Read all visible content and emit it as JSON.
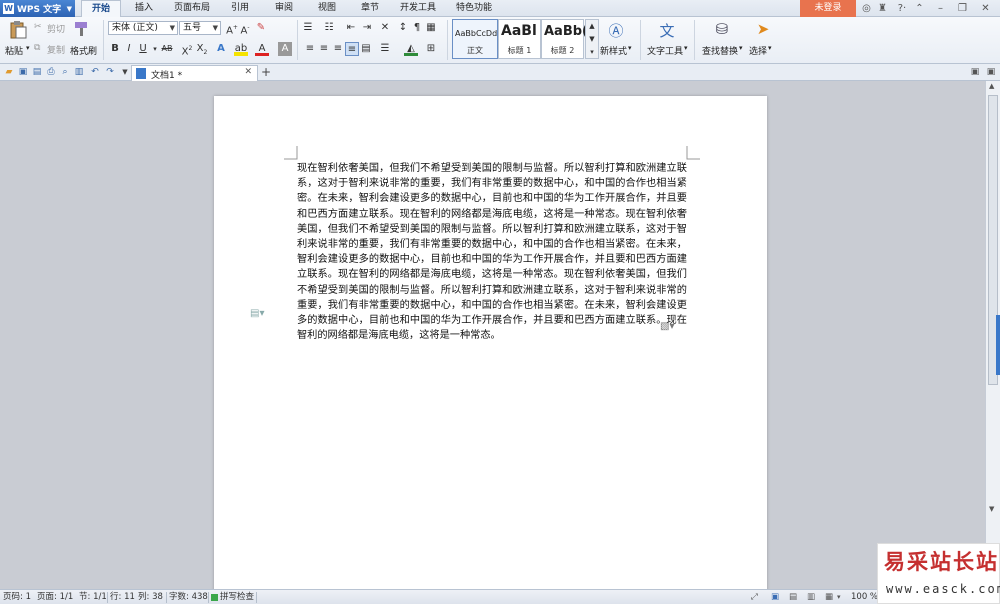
{
  "titlebar": {
    "app_name": "WPS 文字",
    "menu_tabs": [
      "开始",
      "插入",
      "页面布局",
      "引用",
      "审阅",
      "视图",
      "章节",
      "开发工具",
      "特色功能"
    ],
    "login": "未登录"
  },
  "ribbon": {
    "paste": "粘贴",
    "cut": "剪切",
    "copy": "复制",
    "format_painter": "格式刷",
    "font_name": "宋体 (正文)",
    "font_size": "五号",
    "styles": [
      {
        "sample": "AaBbCcDd",
        "label": "正文"
      },
      {
        "sample": "AaBl",
        "label": "标题 1"
      },
      {
        "sample": "AaBb(",
        "label": "标题 2"
      }
    ],
    "new_style": "新样式",
    "text_tools": "文字工具",
    "find_replace": "查找替换",
    "select": "选择"
  },
  "doc_tab": {
    "title": "文档1 *"
  },
  "document": {
    "text": "现在智利依奢美国，但我们不希望受到美国的限制与监督。所以智利打算和欧洲建立联系，这对于智利来说非常的重要，我们有非常重要的数据中心，和中国的合作也相当紧密。在未来，智利会建设更多的数据中心，目前也和中国的华为工作开展合作，并且要和巴西方面建立联系。现在智利的网络都是海底电缆，这将是一种常态。现在智利依奢美国，但我们不希望受到美国的限制与监督。所以智利打算和欧洲建立联系，这对于智利来说非常的重要，我们有非常重要的数据中心，和中国的合作也相当紧密。在未来，智利会建设更多的数据中心，目前也和中国的华为工作开展合作，并且要和巴西方面建立联系。现在智利的网络都是海底电缆，这将是一种常态。现在智利依奢美国，但我们不希望受到美国的限制与监督。所以智利打算和欧洲建立联系，这对于智利来说非常的重要，我们有非常重要的数据中心，和中国的合作也相当紧密。在未来，智利会建设更多的数据中心，目前也和中国的华为工作开展合作，并且要和巴西方面建立联系。现在智利的网络都是海底电缆，这将是一种常态。"
  },
  "statusbar": {
    "page_no": "页码: 1",
    "pages": "页面: 1/1",
    "section": "节: 1/1",
    "row": "行: 11",
    "col": "列: 38",
    "word_count": "字数: 438",
    "spell_check": "拼写检查",
    "zoom": "100 %"
  },
  "watermark": {
    "title": "易采站长站",
    "url": "www.easck.com"
  }
}
